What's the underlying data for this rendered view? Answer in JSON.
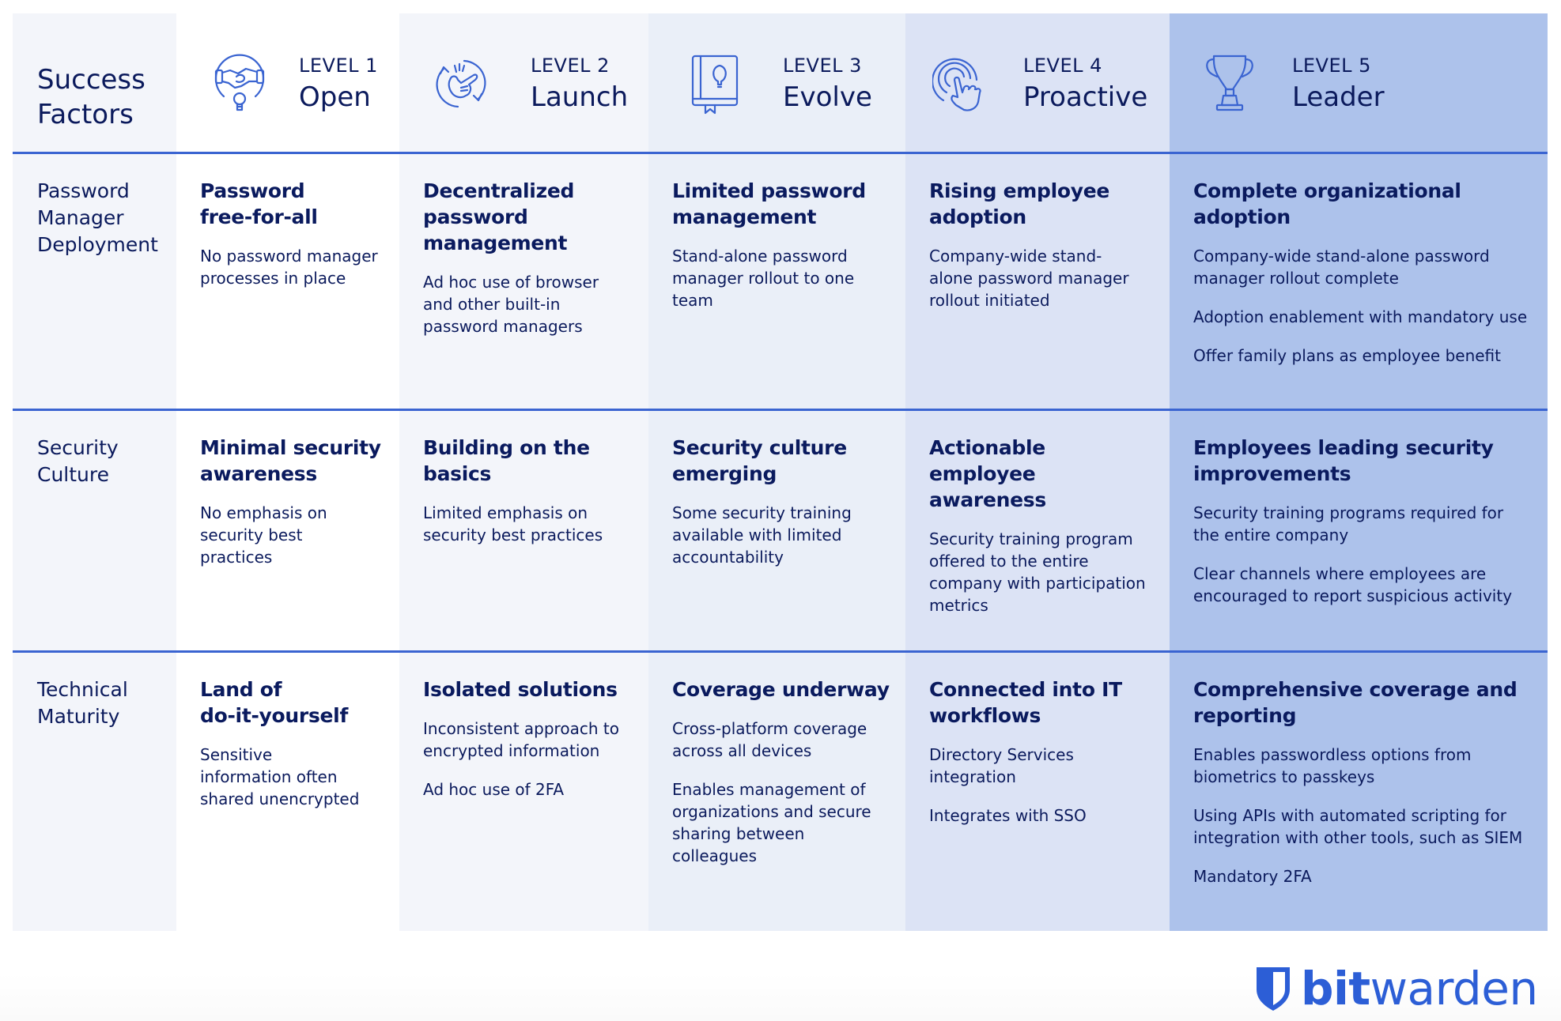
{
  "header": {
    "factors_label_line1": "Success",
    "factors_label_line2": "Factors",
    "levels": [
      {
        "number": "LEVEL 1",
        "name": "Open",
        "icon": "handshake-lightbulb-icon"
      },
      {
        "number": "LEVEL 2",
        "name": "Launch",
        "icon": "snap-fingers-cycle-icon"
      },
      {
        "number": "LEVEL 3",
        "name": "Evolve",
        "icon": "book-lightbulb-icon"
      },
      {
        "number": "LEVEL 4",
        "name": "Proactive",
        "icon": "touch-tap-icon"
      },
      {
        "number": "LEVEL 5",
        "name": "Leader",
        "icon": "trophy-icon"
      }
    ]
  },
  "rows": [
    {
      "factor": [
        "Password",
        "Manager",
        "Deployment"
      ],
      "cells": [
        {
          "title": [
            "Password",
            "free-for-all"
          ],
          "lines": [
            "No password manager processes in place"
          ]
        },
        {
          "title": [
            "Decentralized",
            "password",
            "management"
          ],
          "lines": [
            "Ad hoc use of browser and other built-in password managers"
          ]
        },
        {
          "title": [
            "Limited password",
            "management"
          ],
          "lines": [
            "Stand-alone password manager rollout to one team"
          ]
        },
        {
          "title": [
            "Rising employee",
            "adoption"
          ],
          "lines": [
            "Company-wide stand-alone password manager rollout initiated"
          ]
        },
        {
          "title": [
            "Complete organizational",
            "adoption"
          ],
          "lines": [
            "Company-wide stand-alone password manager rollout complete",
            "Adoption enablement with mandatory use",
            "Offer family plans as employee benefit"
          ]
        }
      ]
    },
    {
      "factor": [
        "Security",
        "Culture"
      ],
      "cells": [
        {
          "title": [
            "Minimal security",
            "awareness"
          ],
          "lines": [
            "No emphasis on security best practices"
          ]
        },
        {
          "title": [
            "Building on the",
            "basics"
          ],
          "lines": [
            "Limited emphasis on security best practices"
          ]
        },
        {
          "title": [
            "Security culture",
            "emerging"
          ],
          "lines": [
            "Some security training available with limited accountability"
          ]
        },
        {
          "title": [
            "Actionable employee",
            "awareness"
          ],
          "lines": [
            "Security training program offered to the entire company with participation metrics"
          ]
        },
        {
          "title": [
            "Employees leading security",
            "improvements"
          ],
          "lines": [
            "Security training programs required for the entire company",
            "Clear channels where employees are encouraged to report suspicious activity"
          ]
        }
      ]
    },
    {
      "factor": [
        "Technical",
        "Maturity"
      ],
      "cells": [
        {
          "title": [
            "Land of",
            "do-it-yourself"
          ],
          "lines": [
            "Sensitive information often shared unencrypted"
          ]
        },
        {
          "title": [
            "Isolated solutions"
          ],
          "lines": [
            "Inconsistent approach to encrypted information",
            "Ad hoc use of 2FA"
          ]
        },
        {
          "title": [
            "Coverage underway"
          ],
          "lines": [
            "Cross-platform coverage across all devices",
            "Enables management of organizations and secure sharing between colleagues"
          ]
        },
        {
          "title": [
            "Connected into IT",
            "workflows"
          ],
          "lines": [
            "Directory Services integration",
            "Integrates with SSO"
          ]
        },
        {
          "title": [
            "Comprehensive coverage and",
            "reporting"
          ],
          "lines": [
            "Enables passwordless options from biometrics to passkeys",
            "Using APIs with automated scripting for integration with other tools, such as SIEM",
            "Mandatory 2FA"
          ]
        }
      ]
    }
  ],
  "logo": {
    "bold": "bit",
    "light": "warden",
    "icon": "shield-icon"
  },
  "colors": {
    "accent": "#3a64d1",
    "text": "#0b1a5c",
    "level1_bg": "#ffffff",
    "level2_bg": "#f3f5fa",
    "level3_bg": "#eaeff8",
    "level4_bg": "#dce3f5",
    "level5_bg": "#adc2eb",
    "logo": "#2c5ed6"
  }
}
